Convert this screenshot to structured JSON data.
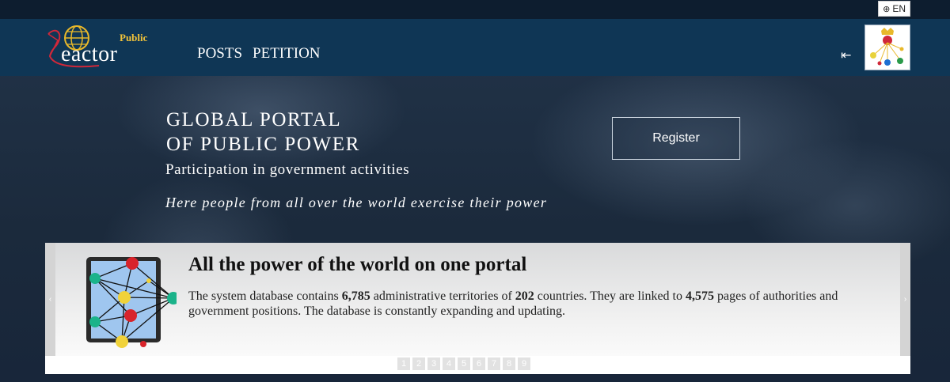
{
  "language": {
    "label": "EN",
    "icon": "globe-icon"
  },
  "logo": {
    "small": "Public",
    "main": "eactor",
    "initial": "R"
  },
  "nav": [
    {
      "label": "POSTS"
    },
    {
      "label": "PETITION"
    }
  ],
  "hero": {
    "title_line1": "GLOBAL PORTAL",
    "title_line2": "OF PUBLIC POWER",
    "subtitle": "Participation in government activities",
    "tagline": "Here people from all over the world exercise their power",
    "register_label": "Register"
  },
  "slide": {
    "title": "All the power of the world on one portal",
    "text_1": "The system database contains ",
    "territories": "6,785",
    "text_2": " administrative territories of ",
    "countries": "202",
    "text_3": " countries. They are linked to ",
    "pages": "4,575",
    "text_4": " pages of authorities and government positions. The database is constantly expanding and updating."
  },
  "arrows": {
    "prev": "‹",
    "next": "›"
  },
  "pager": [
    "1",
    "2",
    "3",
    "4",
    "5",
    "6",
    "7",
    "8",
    "9"
  ]
}
